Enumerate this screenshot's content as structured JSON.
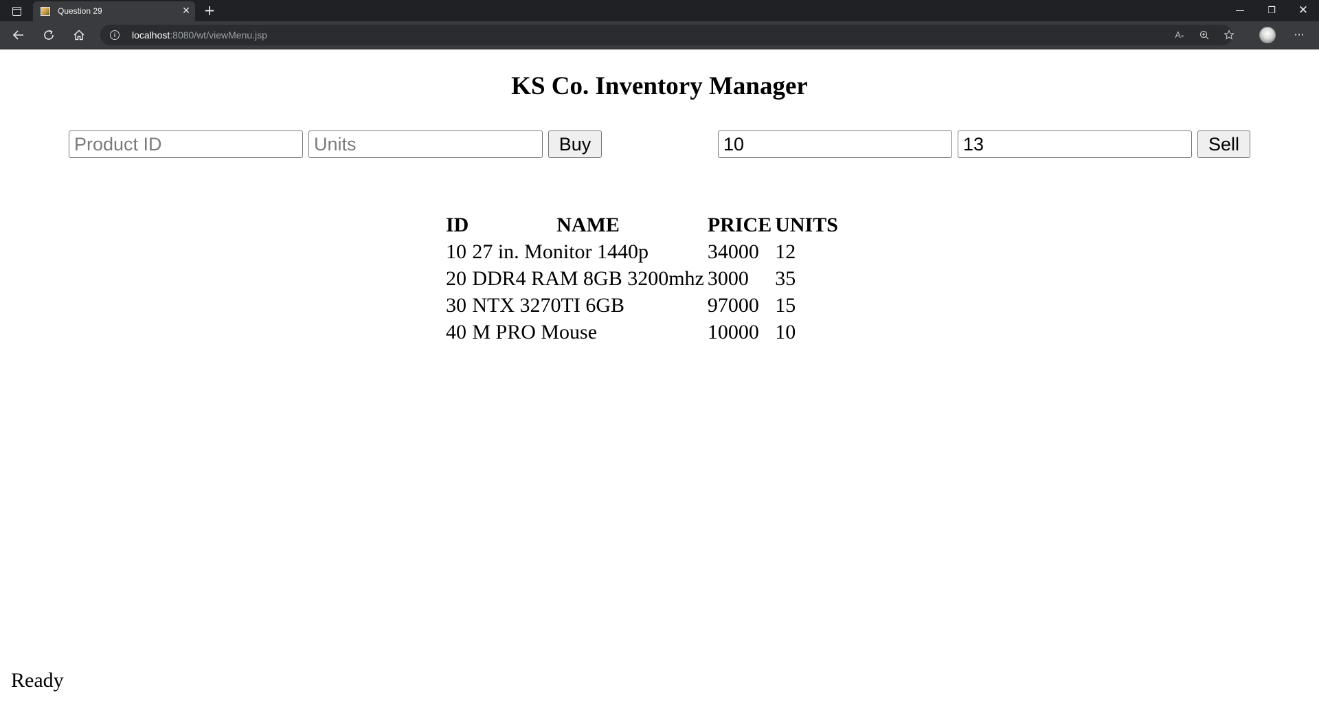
{
  "browser": {
    "tab_title": "Question 29",
    "tab_close_glyph": "✕",
    "new_tab_glyph": "+",
    "url_host": "localhost",
    "url_rest": ":8080/wt/viewMenu.jsp",
    "window_controls": {
      "minimize": "—",
      "restore": "❐",
      "close": "✕"
    },
    "more_glyph": "···",
    "icons": [
      "tab-actions-icon",
      "back-arrow-icon",
      "reload-icon",
      "home-icon",
      "site-info-icon",
      "read-aloud-icon",
      "zoom-icon",
      "favorites-icon",
      "profile-avatar",
      "more-icon"
    ]
  },
  "page": {
    "title": "KS Co. Inventory Manager",
    "buy_form": {
      "product_id_placeholder": "Product ID",
      "units_placeholder": "Units",
      "button_label": "Buy"
    },
    "sell_form": {
      "product_id_value": "10",
      "units_value": "13",
      "button_label": "Sell"
    },
    "table": {
      "headers": [
        "ID",
        "NAME",
        "PRICE",
        "UNITS"
      ],
      "rows": [
        [
          "10",
          "27 in. Monitor 1440p",
          "34000",
          "12"
        ],
        [
          "20",
          "DDR4 RAM 8GB 3200mhz",
          "3000",
          "35"
        ],
        [
          "30",
          "NTX 3270TI 6GB",
          "97000",
          "15"
        ],
        [
          "40",
          "M PRO Mouse",
          "10000",
          "10"
        ]
      ]
    },
    "status": "Ready"
  }
}
